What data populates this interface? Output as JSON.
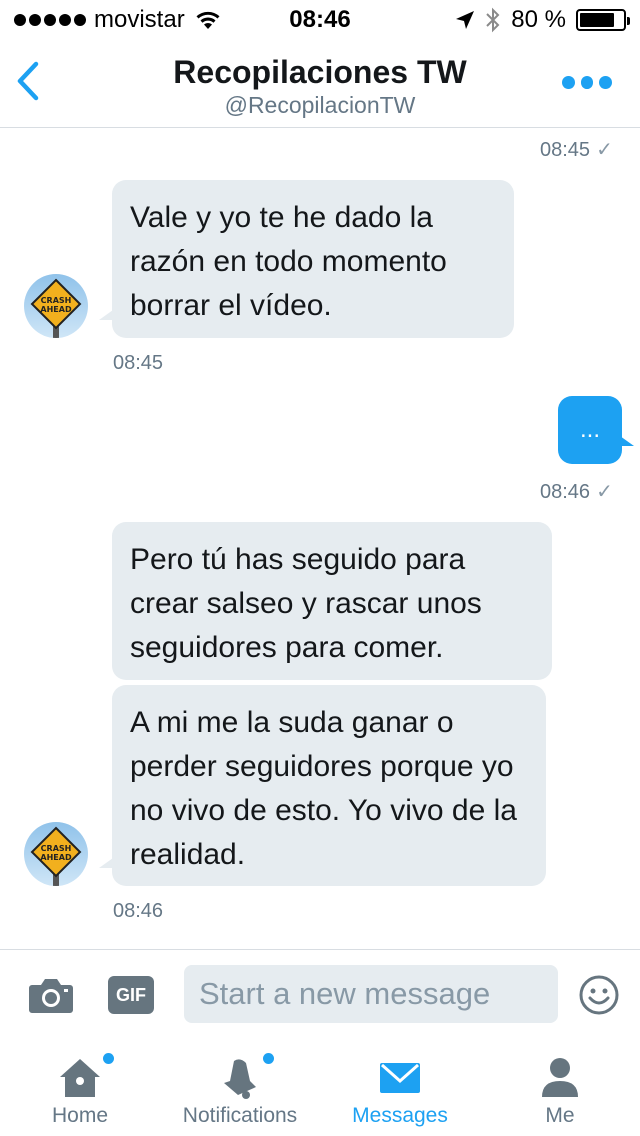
{
  "status_bar": {
    "carrier": "movistar",
    "time": "08:46",
    "battery": "80 %",
    "battery_level": 0.8
  },
  "header": {
    "title": "Recopilaciones TW",
    "handle": "@RecopilacionTW"
  },
  "conversation": {
    "top_timestamp": "08:45",
    "messages": [
      {
        "direction": "in",
        "text": "Vale y yo te he dado la razón en todo momento borrar el vídeo."
      },
      {
        "direction": "in",
        "timestamp": "08:45"
      },
      {
        "direction": "out",
        "text": "...",
        "timestamp": "08:46"
      },
      {
        "direction": "in",
        "text": "Pero tú has seguido para crear salseo y rascar unos seguidores para comer."
      },
      {
        "direction": "in",
        "text": "A mi me la suda ganar o perder seguidores porque yo no vivo de esto. Yo vivo de la realidad.",
        "timestamp": "08:46"
      }
    ],
    "avatar_sign_text": "CRASH AHEAD"
  },
  "composer": {
    "gif_label": "GIF",
    "placeholder": "Start a new message"
  },
  "tabs": [
    {
      "label": "Home",
      "icon": "home-icon",
      "active": false,
      "badge": true
    },
    {
      "label": "Notifications",
      "icon": "bell-icon",
      "active": false,
      "badge": true
    },
    {
      "label": "Messages",
      "icon": "envelope-icon",
      "active": true,
      "badge": false
    },
    {
      "label": "Me",
      "icon": "person-icon",
      "active": false,
      "badge": false
    }
  ],
  "colors": {
    "accent": "#1da1f2",
    "bubble_in": "#e6ecf0",
    "secondary_text": "#657786"
  }
}
